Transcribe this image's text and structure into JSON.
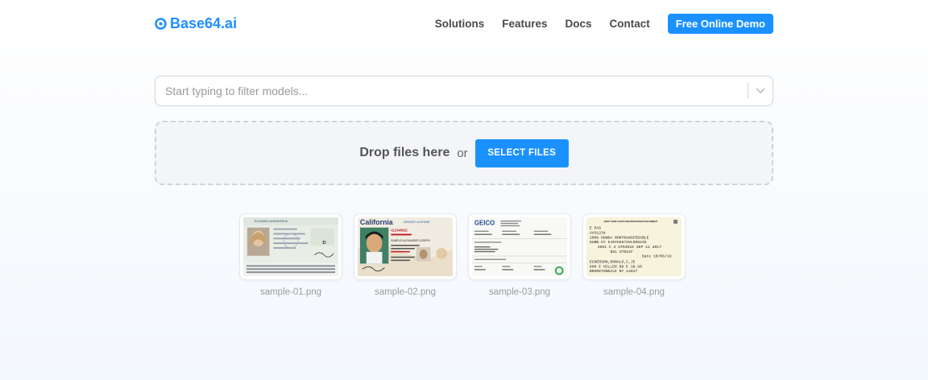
{
  "brand": {
    "name": "Base64.ai",
    "color": "#1e90ff"
  },
  "nav": {
    "items": [
      "Solutions",
      "Features",
      "Docs",
      "Contact"
    ],
    "demo_label": "Free Online Demo"
  },
  "filter": {
    "placeholder": "Start typing to filter models..."
  },
  "dropzone": {
    "text": "Drop files here",
    "or": "or",
    "button_label": "SELECT FILES"
  },
  "samples": [
    {
      "filename": "sample-01.png",
      "header": "ΕΛΛΗΝΙΚΗ ΔΗΜΟΚΡΑΤΙΑ"
    },
    {
      "filename": "sample-02.png",
      "header": "California",
      "badge": "DRIVER LICENSE",
      "dl": "I1234562",
      "name": "SAMPLE ALEXANDER JOSEPH"
    },
    {
      "filename": "sample-03.png",
      "header": "GEICO"
    },
    {
      "filename": "sample-04.png",
      "header": "NEW YORK STATE REGISTRATION DOCUMENT",
      "lines": [
        "E PAS",
        "AVS1234",
        "2009 HONDA NONTRANSFERABLE",
        "SUBN GY  5J6YH28729L005246",
        "3561 C 4  UTD4015  SEP 12 2017",
        "051 UTD21F",
        "Date 10/06/19",
        "ECKERSON,DONALD,C,JE",
        "800 E MILLER RD E    39.50",
        "BROOKTONDALE NY  14817"
      ]
    }
  ],
  "colors": {
    "accent": "#1a91ff"
  }
}
